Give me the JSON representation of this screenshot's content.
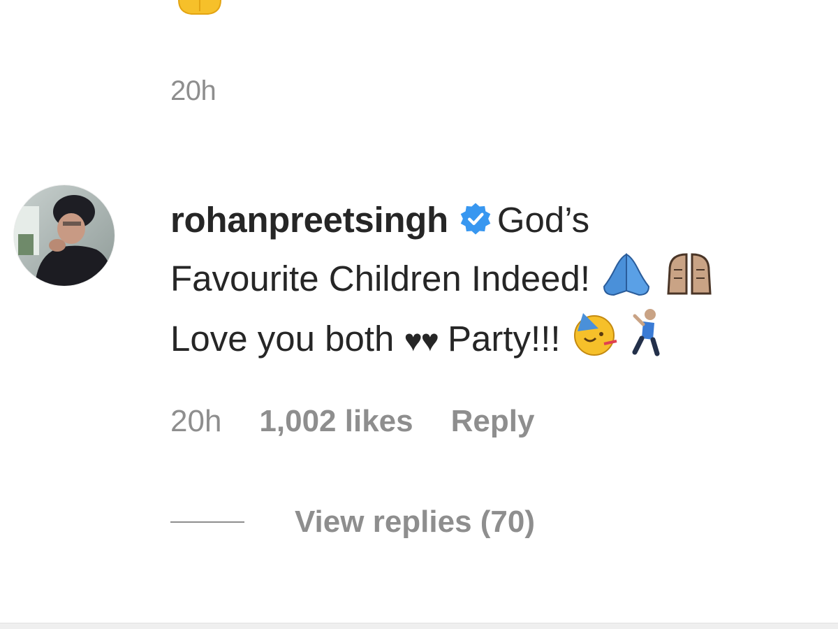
{
  "previous_comment": {
    "emoji": "folded-hands-emoji",
    "time": "20h"
  },
  "comment": {
    "username": "rohanpreetsingh",
    "verified_icon": "verified-badge-icon",
    "text_line1": "God’s",
    "text_line2": "Favourite Children Indeed!",
    "text_line3a": "Love you both",
    "hearts": "♥♥",
    "text_line3b": "Party!!!",
    "emojis": [
      "folded-hands-emoji",
      "raising-hands-emoji",
      "partying-face-emoji",
      "dancing-man-emoji"
    ],
    "time": "20h",
    "likes": "1,002 likes",
    "reply_label": "Reply",
    "view_replies": "View replies (70)"
  },
  "colors": {
    "text": "#262626",
    "secondary": "#8e8e8e",
    "verified_blue": "#3897f0"
  }
}
